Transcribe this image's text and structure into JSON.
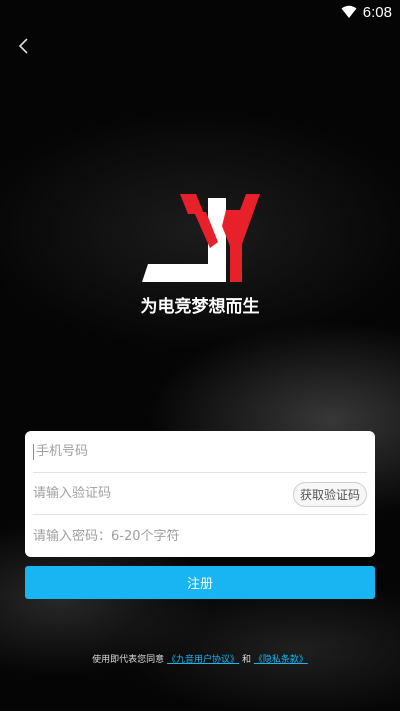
{
  "status_bar": {
    "time": "6:08",
    "icons": [
      "wifi-icon"
    ]
  },
  "header": {
    "back_icon": "chevron-left-icon"
  },
  "brand": {
    "logo_letters": "JY",
    "slogan": "为电竞梦想而生",
    "colors": {
      "white": "#ffffff",
      "red": "#e8202a"
    }
  },
  "form": {
    "phone_placeholder": "手机号码",
    "code_placeholder": "请输入验证码",
    "get_code_label": "获取验证码",
    "password_placeholder": "请输入密码：6-20个字符"
  },
  "actions": {
    "register_label": "注册",
    "register_color": "#18b5f2"
  },
  "agreement": {
    "prefix": "使用即代表您同意",
    "user_agreement": "《九音用户协议》",
    "conjunction": "和",
    "privacy_policy": "《隐私条款》"
  }
}
